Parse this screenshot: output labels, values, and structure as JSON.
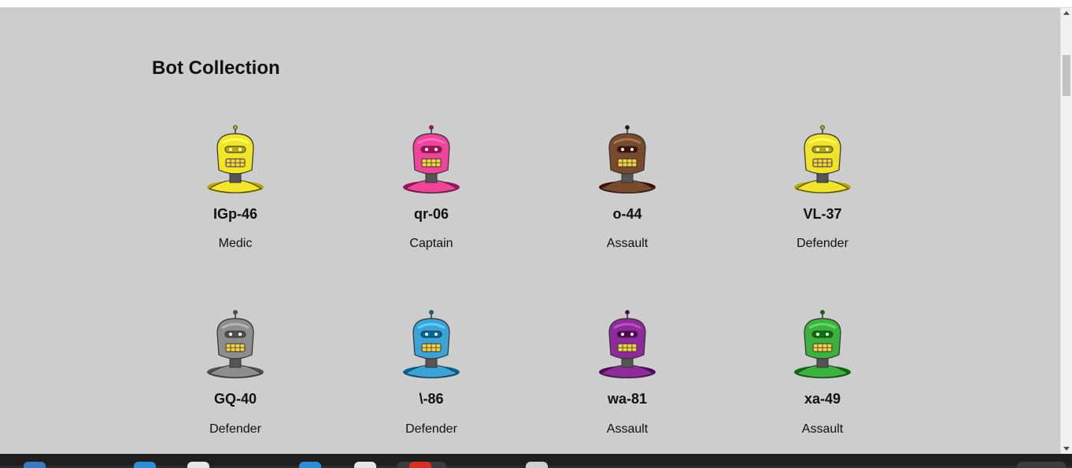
{
  "page": {
    "title": "Bot Collection"
  },
  "bots": [
    {
      "name": "IGp-46",
      "role": "Medic",
      "avatar": "yellow-robot-icon",
      "color": "#f2e52a"
    },
    {
      "name": "qr-06",
      "role": "Captain",
      "avatar": "pink-robot-icon",
      "color": "#f0449a"
    },
    {
      "name": "o-44",
      "role": "Assault",
      "avatar": "brown-robot-icon",
      "color": "#7a4a2c"
    },
    {
      "name": "VL-37",
      "role": "Defender",
      "avatar": "yellow-robot-icon",
      "color": "#f0e32c"
    },
    {
      "name": "GQ-40",
      "role": "Defender",
      "avatar": "gray-robot-icon",
      "color": "#8d8d8d"
    },
    {
      "name": "\\-86",
      "role": "Defender",
      "avatar": "blue-robot-icon",
      "color": "#3aa3d8"
    },
    {
      "name": "wa-81",
      "role": "Assault",
      "avatar": "purple-robot-icon",
      "color": "#8f2a9c"
    },
    {
      "name": "xa-49",
      "role": "Assault",
      "avatar": "green-robot-icon",
      "color": "#3bb13e"
    }
  ],
  "colors": {
    "page_background": "#cdcdcd",
    "text": "#111111",
    "taskbar": "#1f1f1f"
  }
}
